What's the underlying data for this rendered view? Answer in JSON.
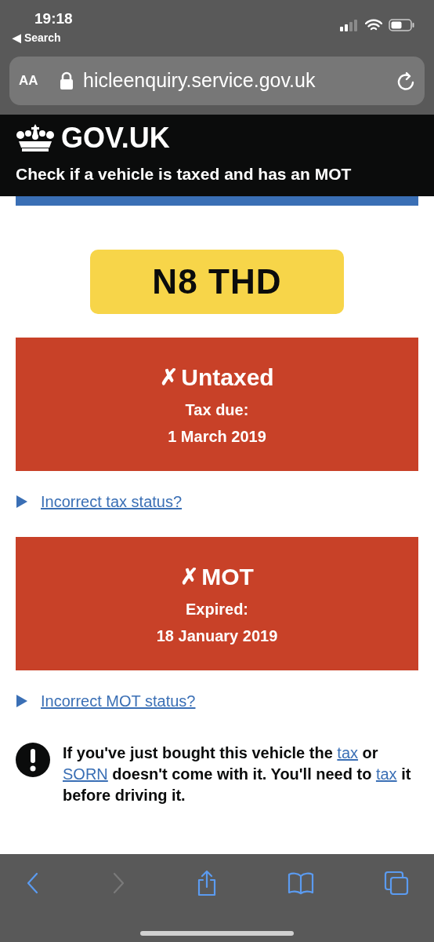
{
  "status_bar": {
    "time": "19:18",
    "back_label": "◀ Search"
  },
  "browser": {
    "text_size": "AA",
    "url": "hicleenquiry.service.gov.uk"
  },
  "header": {
    "logo": "GOV.UK",
    "service": "Check if a vehicle is taxed and has an MOT"
  },
  "plate": "N8 THD",
  "statuses": [
    {
      "mark": "✗",
      "title": "Untaxed",
      "label": "Tax due:",
      "date": "1 March 2019",
      "link": "Incorrect tax status?",
      "expanded": false
    },
    {
      "mark": "✗",
      "title": "MOT",
      "label": "Expired:",
      "date": "18 January 2019",
      "link": "Incorrect MOT status?",
      "expanded": false
    }
  ],
  "warning": {
    "parts": [
      {
        "kind": "text",
        "text": "If you've just bought this vehicle the "
      },
      {
        "kind": "link",
        "text": "tax"
      },
      {
        "kind": "text",
        "text": " or "
      },
      {
        "kind": "link",
        "text": "SORN"
      },
      {
        "kind": "text",
        "text": " doesn't come with it. You'll need to "
      },
      {
        "kind": "link",
        "text": "tax"
      },
      {
        "kind": "text",
        "text": " it before driving it."
      }
    ]
  },
  "toolbar": [
    {
      "kind": "back",
      "disabled": false
    },
    {
      "kind": "forward",
      "disabled": true
    },
    {
      "kind": "share",
      "disabled": false
    },
    {
      "kind": "bookmarks",
      "disabled": false
    },
    {
      "kind": "tabs",
      "disabled": false
    }
  ]
}
